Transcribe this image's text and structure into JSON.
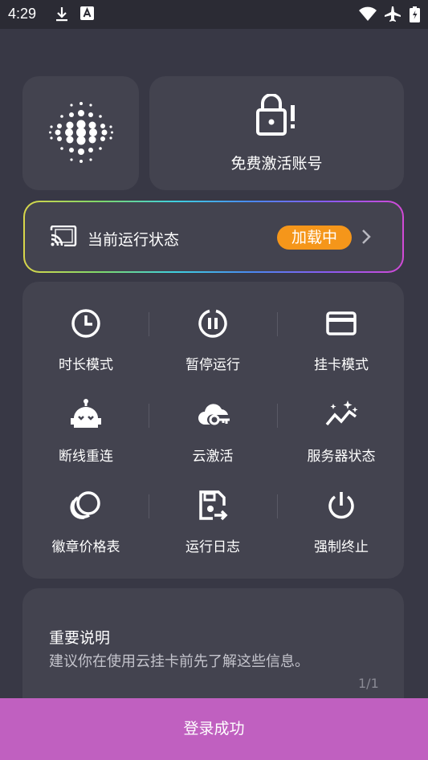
{
  "status_bar": {
    "time": "4:29",
    "left_icons": [
      "download-icon",
      "a-letter-icon"
    ],
    "right_icons": [
      "wifi-icon",
      "airplane-mode-icon",
      "battery-charging-icon"
    ]
  },
  "logo": {
    "icon": "dot-matrix-logo-icon"
  },
  "activate": {
    "icon": "lock-alert-icon",
    "label": "免费激活账号"
  },
  "run_status": {
    "icon": "cast-icon",
    "label": "当前运行状态",
    "badge": "加载中",
    "badge_color": "#f5961a"
  },
  "features": [
    {
      "label": "时长模式",
      "icon": "clock-icon"
    },
    {
      "label": "暂停运行",
      "icon": "pause-circle-icon"
    },
    {
      "label": "挂卡模式",
      "icon": "credit-card-icon"
    },
    {
      "label": "断线重连",
      "icon": "robot-icon"
    },
    {
      "label": "云激活",
      "icon": "cloud-key-icon"
    },
    {
      "label": "服务器状态",
      "icon": "sparkle-chart-icon"
    },
    {
      "label": "徽章价格表",
      "icon": "circles-icon"
    },
    {
      "label": "运行日志",
      "icon": "log-export-icon"
    },
    {
      "label": "强制终止",
      "icon": "power-icon"
    }
  ],
  "notice": {
    "title": "重要说明",
    "text": "建议你在使用云挂卡前先了解这些信息。",
    "pager": "1/1"
  },
  "bottom_button": {
    "label": "登录成功",
    "color": "#c060c0"
  },
  "colors": {
    "background": "#383845",
    "card": "#43434f",
    "status_bar": "#2b2b34"
  }
}
